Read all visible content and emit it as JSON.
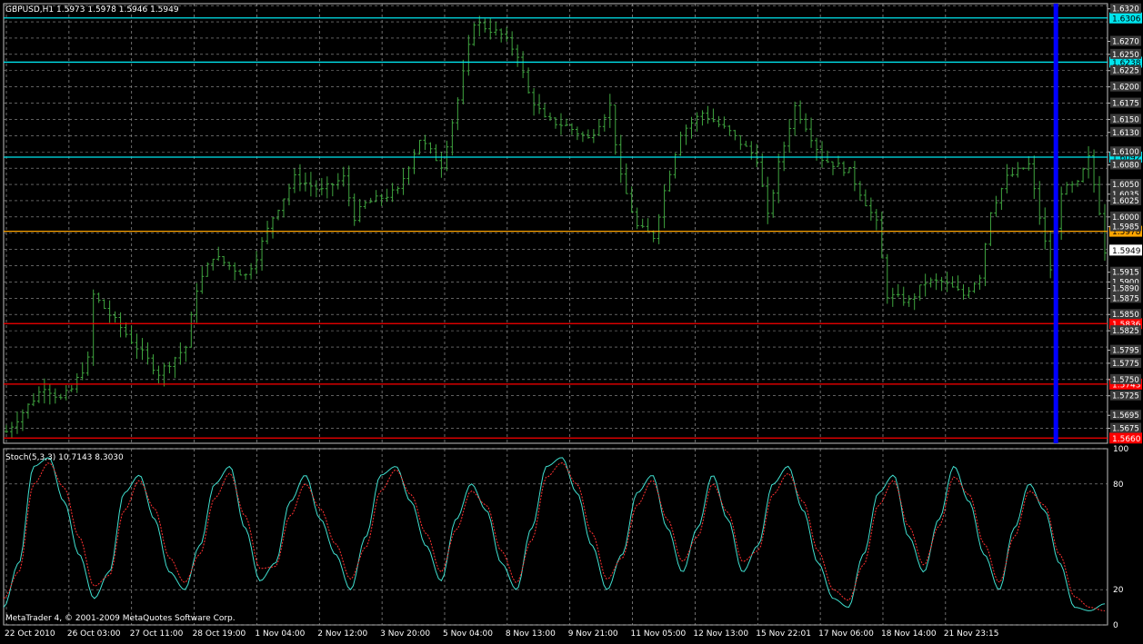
{
  "chart_data": [
    {
      "type": "bar",
      "header": "GBPUSD,H1  1.5973 1.5978 1.5946 1.5949",
      "symbol": "GBPUSD",
      "timeframe": "H1",
      "ylim": [
        1.5652,
        1.6328
      ],
      "y_ticks": [
        "1.6320",
        "1.6270",
        "1.6250",
        "1.6225",
        "1.6200",
        "1.6175",
        "1.6150",
        "1.6130",
        "1.6100",
        "1.6080",
        "1.6050",
        "1.6035",
        "1.6025",
        "1.6000",
        "1.5985",
        "1.5915",
        "1.5900",
        "1.5890",
        "1.5875",
        "1.5850",
        "1.5825",
        "1.5795",
        "1.5775",
        "1.5750",
        "1.5725",
        "1.5695",
        "1.5675"
      ],
      "x_tick_labels": [
        "22 Oct 2010",
        "26 Oct 03:00",
        "27 Oct 11:00",
        "28 Oct 19:00",
        "1 Nov 04:00",
        "2 Nov 12:00",
        "3 Nov 20:00",
        "5 Nov 04:00",
        "8 Nov 13:00",
        "9 Nov 21:00",
        "11 Nov 05:00",
        "12 Nov 13:00",
        "15 Nov 22:01",
        "17 Nov 06:00",
        "18 Nov 14:00",
        "21 Nov 23:15"
      ],
      "price_path": [
        [
          0,
          1.567
        ],
        [
          4,
          1.571
        ],
        [
          7,
          1.574
        ],
        [
          10,
          1.572
        ],
        [
          12,
          1.5735
        ],
        [
          15,
          1.578
        ],
        [
          16,
          1.588
        ],
        [
          20,
          1.584
        ],
        [
          24,
          1.58
        ],
        [
          28,
          1.576
        ],
        [
          33,
          1.58
        ],
        [
          35,
          1.589
        ],
        [
          38,
          1.594
        ],
        [
          44,
          1.591
        ],
        [
          46,
          1.594
        ],
        [
          49,
          1.6
        ],
        [
          53,
          1.606
        ],
        [
          58,
          1.604
        ],
        [
          62,
          1.606
        ],
        [
          64,
          1.6
        ],
        [
          66,
          1.602
        ],
        [
          69,
          1.603
        ],
        [
          72,
          1.604
        ],
        [
          76,
          1.612
        ],
        [
          80,
          1.608
        ],
        [
          83,
          1.618
        ],
        [
          86,
          1.63
        ],
        [
          91,
          1.628
        ],
        [
          94,
          1.625
        ],
        [
          96,
          1.619
        ],
        [
          99,
          1.615
        ],
        [
          103,
          1.614
        ],
        [
          107,
          1.612
        ],
        [
          111,
          1.617
        ],
        [
          113,
          1.606
        ],
        [
          116,
          1.5985
        ],
        [
          119,
          1.597
        ],
        [
          121,
          1.604
        ],
        [
          124,
          1.613
        ],
        [
          128,
          1.616
        ],
        [
          133,
          1.613
        ],
        [
          138,
          1.609
        ],
        [
          140,
          1.6
        ],
        [
          142,
          1.608
        ],
        [
          145,
          1.617
        ],
        [
          147,
          1.614
        ],
        [
          150,
          1.609
        ],
        [
          155,
          1.607
        ],
        [
          160,
          1.599
        ],
        [
          162,
          1.588
        ],
        [
          166,
          1.587
        ],
        [
          169,
          1.59
        ],
        [
          172,
          1.59
        ],
        [
          176,
          1.588
        ],
        [
          179,
          1.591
        ],
        [
          181,
          1.601
        ],
        [
          184,
          1.606
        ],
        [
          186,
          1.607
        ],
        [
          188,
          1.608
        ],
        [
          190,
          1.6
        ],
        [
          192,
          1.592
        ],
        [
          194,
          1.604
        ],
        [
          197,
          1.605
        ],
        [
          199,
          1.609
        ],
        [
          201,
          1.601
        ],
        [
          202,
          1.5949
        ]
      ],
      "horizontal_levels": [
        {
          "label": "1.6306",
          "value": 1.6306,
          "color": "#00e5ee"
        },
        {
          "label": "1.6238",
          "value": 1.6238,
          "color": "#00e5ee"
        },
        {
          "label": "1.6092",
          "value": 1.6092,
          "color": "#00e5ee"
        },
        {
          "label": "1.5978",
          "value": 1.5978,
          "color": "#ffa500"
        },
        {
          "label": "1.5949",
          "value": 1.5949,
          "color": "#ffffff"
        },
        {
          "label": "1.5836",
          "value": 1.5836,
          "color": "#ff0000"
        },
        {
          "label": "1.5743",
          "value": 1.5743,
          "color": "#ff0000"
        },
        {
          "label": "1.5660",
          "value": 1.566,
          "color": "#ff0000"
        }
      ],
      "vertical_marker_bar_index": 193,
      "colors": {
        "bars": "#3fa53f",
        "grid": "#9a9a9a",
        "marker": "#0000ff"
      }
    },
    {
      "type": "line",
      "header": "Stoch(5,3,3) 10.7143 8.3030",
      "ylim": [
        0,
        100
      ],
      "y_ticks": [
        "100",
        "80",
        "20",
        "0"
      ],
      "series": [
        {
          "color": "#40e0d0",
          "values": [
            10,
            35,
            90,
            95,
            70,
            40,
            15,
            30,
            75,
            85,
            60,
            30,
            20,
            45,
            80,
            90,
            55,
            25,
            35,
            70,
            85,
            60,
            40,
            20,
            50,
            85,
            90,
            70,
            45,
            25,
            60,
            80,
            65,
            35,
            20,
            55,
            90,
            95,
            75,
            45,
            20,
            40,
            75,
            85,
            55,
            30,
            55,
            85,
            60,
            30,
            45,
            80,
            90,
            65,
            35,
            15,
            10,
            40,
            75,
            85,
            50,
            30,
            60,
            90,
            70,
            40,
            20,
            55,
            80,
            65,
            35,
            10,
            8,
            12
          ]
        },
        {
          "color": "#ff3030",
          "values": [
            15,
            30,
            80,
            92,
            78,
            50,
            22,
            28,
            65,
            82,
            66,
            38,
            24,
            40,
            72,
            86,
            62,
            32,
            33,
            62,
            80,
            66,
            46,
            26,
            44,
            76,
            88,
            74,
            52,
            30,
            54,
            76,
            68,
            42,
            24,
            48,
            84,
            92,
            80,
            52,
            26,
            38,
            68,
            82,
            60,
            36,
            50,
            80,
            64,
            36,
            42,
            74,
            86,
            70,
            42,
            20,
            14,
            34,
            68,
            82,
            56,
            34,
            56,
            84,
            74,
            46,
            24,
            50,
            76,
            68,
            40,
            16,
            10,
            8
          ]
        }
      ]
    }
  ],
  "copyright": "MetaTrader 4, © 2001-2009 MetaQuotes Software Corp."
}
